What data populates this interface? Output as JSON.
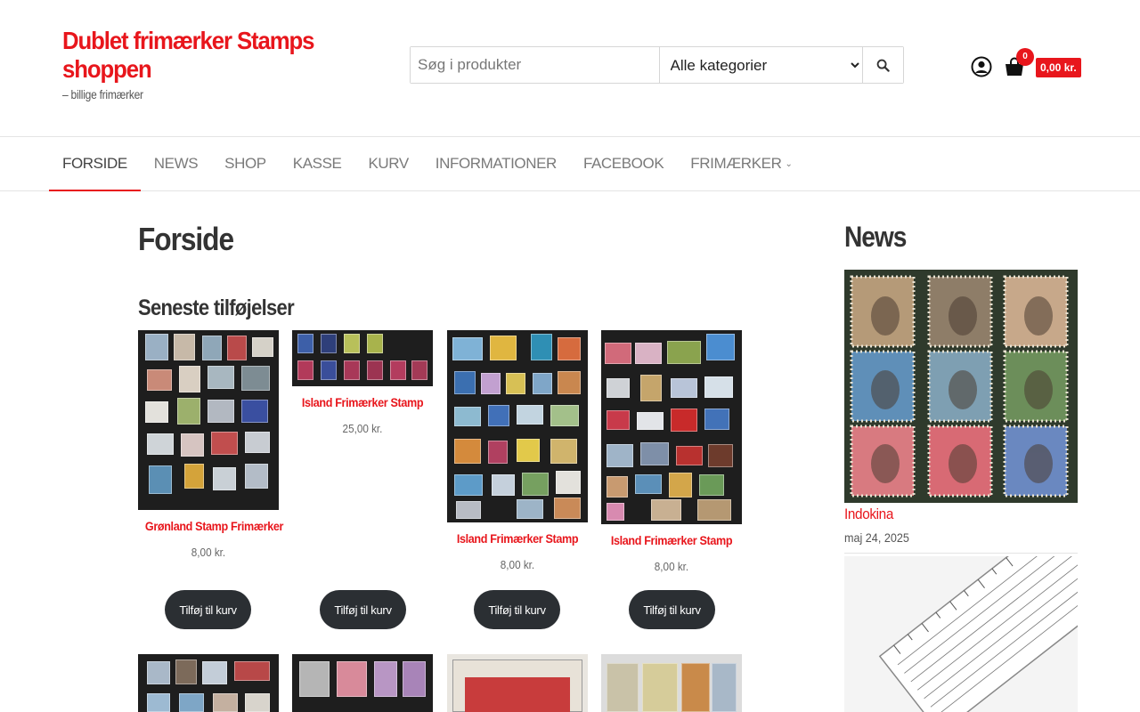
{
  "site": {
    "title": "Dublet frimærker Stamps shoppen",
    "description": "– billige frimærker"
  },
  "search": {
    "placeholder": "Søg i produkter",
    "category_selected": "Alle kategorier",
    "button_icon": "search-icon"
  },
  "cart": {
    "count": "0",
    "total": "0,00 kr.",
    "icon": "shopping-bag-icon"
  },
  "account": {
    "icon": "user-circle-icon"
  },
  "nav": {
    "items": [
      {
        "label": "FORSIDE",
        "active": true
      },
      {
        "label": "NEWS"
      },
      {
        "label": "SHOP"
      },
      {
        "label": "KASSE"
      },
      {
        "label": "KURV"
      },
      {
        "label": "INFORMATIONER"
      },
      {
        "label": "FACEBOOK"
      },
      {
        "label": "FRIMÆRKER",
        "has_dropdown": true
      }
    ]
  },
  "main": {
    "page_title": "Forside",
    "section_title": "Seneste tilføjelser",
    "add_to_cart_label": "Tilføj til kurv",
    "products": [
      {
        "name": "Grønland Stamp Frimærker",
        "price": "8,00 kr."
      },
      {
        "name": "Island Frimærker Stamp",
        "price": "25,00 kr."
      },
      {
        "name": "Island Frimærker Stamp",
        "price": "8,00 kr."
      },
      {
        "name": "Island Frimærker Stamp",
        "price": "8,00 kr."
      }
    ]
  },
  "sidebar": {
    "title": "News",
    "posts": [
      {
        "title": "Indokina",
        "date": "maj 24, 2025"
      }
    ]
  },
  "colors": {
    "accent": "#e8161c",
    "button_dark": "#2b2f33"
  }
}
